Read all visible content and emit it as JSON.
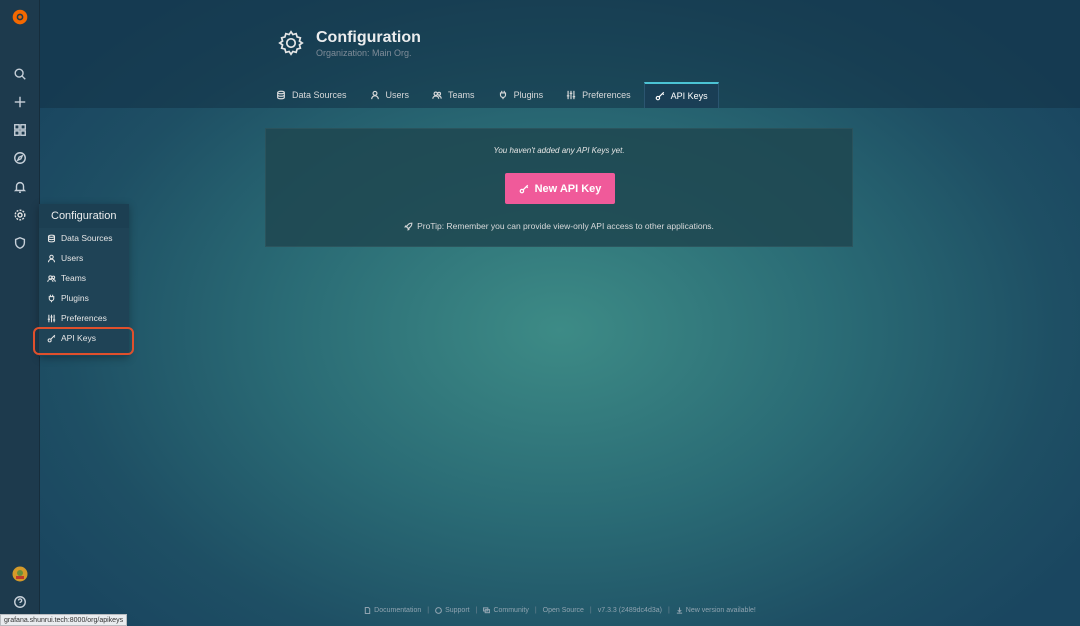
{
  "colors": {
    "accent_tab": "#4cc3d4",
    "primary_button": "#f05a9a",
    "highlight": "#e0502c",
    "logo": "#f46800"
  },
  "sidebar": {
    "icons": [
      "grafana-logo-icon",
      "search-icon",
      "plus-icon",
      "dashboards-icon",
      "explore-icon",
      "alerting-icon",
      "configuration-icon",
      "shield-icon",
      "user-avatar-icon",
      "help-icon"
    ]
  },
  "header": {
    "title": "Configuration",
    "subtitle": "Organization: Main Org."
  },
  "tabs": [
    {
      "label": "Data Sources",
      "icon": "database-icon"
    },
    {
      "label": "Users",
      "icon": "user-icon"
    },
    {
      "label": "Teams",
      "icon": "users-icon"
    },
    {
      "label": "Plugins",
      "icon": "plug-icon"
    },
    {
      "label": "Preferences",
      "icon": "sliders-icon"
    },
    {
      "label": "API Keys",
      "icon": "key-icon",
      "active": true
    }
  ],
  "empty_state": {
    "title": "You haven't added any API Keys yet.",
    "button_label": "New API Key",
    "protip": "ProTip: Remember you can provide view-only API access to other applications."
  },
  "flyout": {
    "title": "Configuration",
    "items": [
      {
        "label": "Data Sources"
      },
      {
        "label": "Users"
      },
      {
        "label": "Teams"
      },
      {
        "label": "Plugins"
      },
      {
        "label": "Preferences"
      },
      {
        "label": "API Keys",
        "highlighted": true
      }
    ]
  },
  "footer": {
    "documentation": "Documentation",
    "support": "Support",
    "community": "Community",
    "open_source": "Open Source",
    "version": "v7.3.3 (2489dc4d3a)",
    "new_version": "New version available!"
  },
  "status_url": "grafana.shunrui.tech:8000/org/apikeys"
}
